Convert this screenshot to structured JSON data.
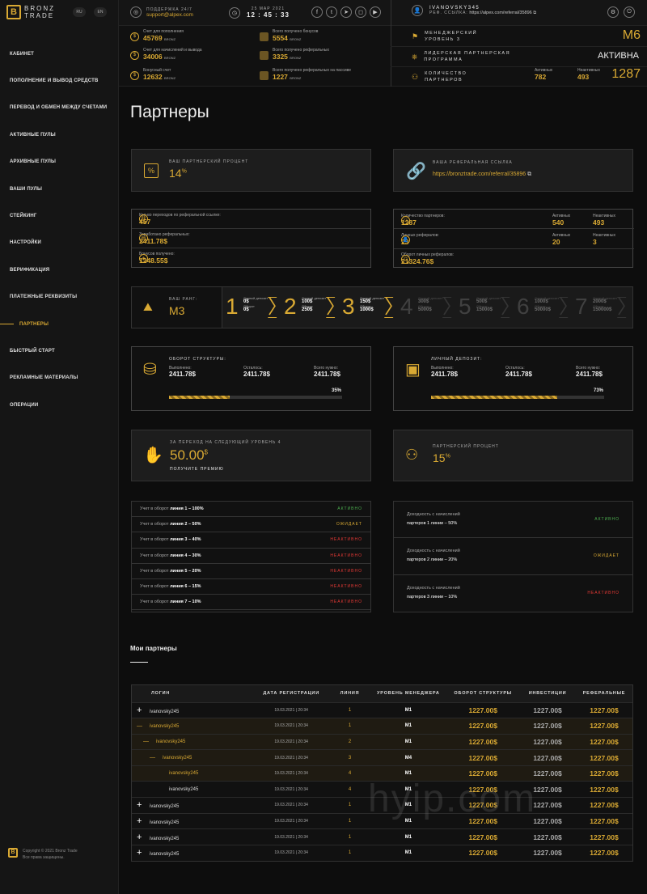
{
  "brand": {
    "line1": "BRONZ",
    "line2": "TRADE",
    "langs": [
      "RU",
      "EN"
    ]
  },
  "nav": [
    "КАБИНЕТ",
    "ПОПОЛНЕНИЕ И ВЫВОД СРЕДСТВ",
    "ПЕРЕВОД И ОБМЕН МЕЖДУ СЧЕТАМИ",
    "АКТИВНЫЕ ПУЛЫ",
    "АРХИВНЫЕ ПУЛЫ",
    "ВАШИ ПУЛЫ",
    "СТЕЙКИНГ",
    "НАСТРОЙКИ",
    "ВЕРИФИКАЦИЯ",
    "ПЛАТЕЖНЫЕ РЕКВИЗИТЫ",
    "ПАРТНЕРЫ",
    "БЫСТРЫЙ СТАРТ",
    "РЕКЛАМНЫЕ МАТЕРИАЛЫ",
    "ОПЕРАЦИИ"
  ],
  "copyright": {
    "line1": "Copyright © 2021 Bronz Trade",
    "line2": "Все права защищены."
  },
  "top": {
    "support_label": "ПОДДЕРЖКА 24/7",
    "support_email": "support@alpex.com",
    "date": "25 МАР 2021",
    "time": "12 : 45 : 33",
    "username": "IVANOVSKY345",
    "ref_label": "РЕФ. ССЫЛКА:",
    "ref_link": "https://alpex.com/referral/35896"
  },
  "stats": [
    {
      "label": "Счет для пополнения",
      "value": "45769",
      "unit": "BRONZ"
    },
    {
      "label": "Счет для начислений и вывода",
      "value": "34006",
      "unit": "BRONZ"
    },
    {
      "label": "Бонусный счет",
      "value": "12632",
      "unit": "BRONZ"
    },
    {
      "label": "Всего получено бонусов",
      "value": "5554",
      "unit": "BRONZ"
    },
    {
      "label": "Всего получено реферальных",
      "value": "3325",
      "unit": "BRONZ"
    },
    {
      "label": "Всего получено реферальных на пассиве",
      "value": "1227",
      "unit": "BRONZ"
    }
  ],
  "right": {
    "manager_label1": "МЕНЕДЖЕРСКИЙ",
    "manager_label2": "УРОВЕНЬ 3",
    "manager_value": "M6",
    "leader_label1": "ЛИДЕРСКАЯ ПАРТНЕРСКАЯ",
    "leader_label2": "ПРОГРАММА",
    "leader_value": "АКТИВНА",
    "count_label1": "КОЛИЧЕСТВО",
    "count_label2": "ПАРТНЕРОВ",
    "active_label": "Активных",
    "active_value": "782",
    "inactive_label": "Неактивных",
    "inactive_value": "493",
    "total": "1287"
  },
  "page_title": "Партнеры",
  "percent_card": {
    "label": "ВАШ ПАРТНЕРСКИЙ ПРОЦЕНТ",
    "value": "14",
    "suffix": "%"
  },
  "ref_card": {
    "label": "ВАША РЕФЕРАЛЬНАЯ ССЫЛКА",
    "link": "https://bronztrade.com/referral/35896"
  },
  "left_info": [
    {
      "label": "Кол-во переходов по реферальной ссылке:",
      "value": "457"
    },
    {
      "label": "Заработано реферальных:",
      "value": "2411.78$"
    },
    {
      "label": "Бонусов получено:",
      "value": "1248.55$"
    }
  ],
  "right_info": {
    "partners_label": "Количество партнеров:",
    "partners": "1287",
    "active_label": "Активных",
    "active": "540",
    "inactive_label": "Неактивных",
    "inactive": "493",
    "personal_label": "Личных рефералов:",
    "personal": "23",
    "p_active": "20",
    "p_inactive": "3",
    "turnover_label": "Оборот личных рефералов:",
    "turnover": "21324.76$"
  },
  "rank": {
    "label": "ВАШ РАНГ:",
    "value": "M3",
    "steps": [
      {
        "n": "1",
        "l1": "Личный депозит",
        "v1": "0$",
        "l2": "Оборот",
        "v2": "0$"
      },
      {
        "n": "2",
        "l1": "Личный депозит",
        "v1": "100$",
        "l2": "Оборот",
        "v2": "250$"
      },
      {
        "n": "3",
        "l1": "Личный депозит",
        "v1": "150$",
        "l2": "Оборот",
        "v2": "1000$"
      },
      {
        "n": "4",
        "l1": "Личный депозит",
        "v1": "300$",
        "l2": "Оборот",
        "v2": "5000$"
      },
      {
        "n": "5",
        "l1": "Личный депозит",
        "v1": "500$",
        "l2": "Оборот",
        "v2": "15000$"
      },
      {
        "n": "6",
        "l1": "Личный депозит",
        "v1": "1000$",
        "l2": "Оборот",
        "v2": "50000$"
      },
      {
        "n": "7",
        "l1": "Личный депозит",
        "v1": "2000$",
        "l2": "Оборот",
        "v2": "150000$"
      }
    ]
  },
  "structure": {
    "title": "ОБОРОТ СТРУКТУРЫ:",
    "done_label": "Выполнено:",
    "done": "2411.78$",
    "left_label": "Осталось:",
    "left": "2411.78$",
    "need_label": "Всего нужно:",
    "need": "2411.78$",
    "pct": "35%",
    "fill": 0.35
  },
  "deposit": {
    "title": "ЛИЧНЫЙ ДЕПОЗИТ:",
    "done_label": "Выполнено:",
    "done": "2411.78$",
    "left_label": "Осталось:",
    "left": "2411.78$",
    "need_label": "Всего нужно:",
    "need": "2411.78$",
    "pct": "73%",
    "fill": 0.73
  },
  "next_level": {
    "title": "ЗА ПЕРЕХОД НА СЛЕДУЮЩИЙ УРОВЕНЬ 4",
    "value": "50.00",
    "unit": "$",
    "cta": "ПОЛУЧИТЕ ПРЕМИЮ"
  },
  "partner_pct": {
    "title": "ПАРТНЕРСКИЙ ПРОЦЕНТ",
    "value": "15",
    "suffix": "%"
  },
  "lines": [
    {
      "pre": "Учет в оборот",
      "line": "линия 1 – 100%",
      "status": "АКТИВНО",
      "cls": "a"
    },
    {
      "pre": "Учет в оборот",
      "line": "линия 2 – 50%",
      "status": "ОЖИДАЕТ",
      "cls": "w"
    },
    {
      "pre": "Учет в оборот",
      "line": "линия 3 – 40%",
      "status": "НЕАКТИВНО",
      "cls": "n"
    },
    {
      "pre": "Учет в оборот",
      "line": "линия 4 – 30%",
      "status": "НЕАКТИВНО",
      "cls": "n"
    },
    {
      "pre": "Учет в оборот",
      "line": "линия 5 – 20%",
      "status": "НЕАКТИВНО",
      "cls": "n"
    },
    {
      "pre": "Учет в оборот",
      "line": "линия 6 – 15%",
      "status": "НЕАКТИВНО",
      "cls": "n"
    },
    {
      "pre": "Учет в оборот",
      "line": "линия 7 – 10%",
      "status": "НЕАКТИВНО",
      "cls": "n"
    }
  ],
  "income": [
    {
      "l1": "Доходность с начислений",
      "l2": "партеров 1 линии – 50%",
      "status": "АКТИВНО",
      "cls": "a"
    },
    {
      "l1": "Доходность с начислений",
      "l2": "партеров 2 линии – 20%",
      "status": "ОЖИДАЕТ",
      "cls": "w"
    },
    {
      "l1": "Доходность с начислений",
      "l2": "партеров 3 линии – 10%",
      "status": "НЕАКТИВНО",
      "cls": "n"
    }
  ],
  "partners_title": "Мои партнеры",
  "table": {
    "headers": [
      "ЛОГИН",
      "ДАТА РЕГИСТРАЦИИ",
      "ЛИНИЯ",
      "УРОВЕНЬ МЕНЕДЖЕРА",
      "ОБОРОТ СТРУКТУРЫ",
      "ИНВЕСТИЦИИ",
      "РЕФЕРАЛЬНЫЕ"
    ],
    "rows": [
      {
        "sign": "+",
        "indent": 0,
        "login": "ivanovsky245",
        "date": "19.03.2021 | 20:34",
        "line": "1",
        "level": "M1",
        "turn": "1227.00$",
        "inv": "1227.00$",
        "ref": "1227.00$",
        "gold": false
      },
      {
        "sign": "—",
        "indent": 0,
        "login": "ivanovsky245",
        "date": "19.03.2021 | 20:34",
        "line": "1",
        "level": "M1",
        "turn": "1227.00$",
        "inv": "1227.00$",
        "ref": "1227.00$",
        "gold": true
      },
      {
        "sign": "—",
        "indent": 1,
        "login": "ivanovsky245",
        "date": "19.03.2021 | 20:34",
        "line": "2",
        "level": "M1",
        "turn": "1227.00$",
        "inv": "1227.00$",
        "ref": "1227.00$",
        "gold": true
      },
      {
        "sign": "—",
        "indent": 2,
        "login": "ivanovsky245",
        "date": "19.03.2021 | 20:34",
        "line": "3",
        "level": "M4",
        "turn": "1227.00$",
        "inv": "1227.00$",
        "ref": "1227.00$",
        "gold": true
      },
      {
        "sign": "",
        "indent": 3,
        "login": "ivanovsky245",
        "date": "19.03.2021 | 20:34",
        "line": "4",
        "level": "M1",
        "turn": "1227.00$",
        "inv": "1227.00$",
        "ref": "1227.00$",
        "gold": true
      },
      {
        "sign": "",
        "indent": 3,
        "login": "ivanovsky245",
        "date": "19.03.2021 | 20:34",
        "line": "4",
        "level": "M1",
        "turn": "1227.00$",
        "inv": "1227.00$",
        "ref": "1227.00$",
        "gold": false
      },
      {
        "sign": "+",
        "indent": 0,
        "login": "ivanovsky245",
        "date": "19.03.2021 | 20:34",
        "line": "1",
        "level": "M1",
        "turn": "1227.00$",
        "inv": "1227.00$",
        "ref": "1227.00$",
        "gold": false
      },
      {
        "sign": "+",
        "indent": 0,
        "login": "ivanovsky245",
        "date": "19.03.2021 | 20:34",
        "line": "1",
        "level": "M1",
        "turn": "1227.00$",
        "inv": "1227.00$",
        "ref": "1227.00$",
        "gold": false
      },
      {
        "sign": "+",
        "indent": 0,
        "login": "ivanovsky245",
        "date": "19.03.2021 | 20:34",
        "line": "1",
        "level": "M1",
        "turn": "1227.00$",
        "inv": "1227.00$",
        "ref": "1227.00$",
        "gold": false
      },
      {
        "sign": "+",
        "indent": 0,
        "login": "ivanovsky245",
        "date": "19.03.2021 | 20:34",
        "line": "1",
        "level": "M1",
        "turn": "1227.00$",
        "inv": "1227.00$",
        "ref": "1227.00$",
        "gold": false
      }
    ]
  },
  "watermark": "hyip.com"
}
